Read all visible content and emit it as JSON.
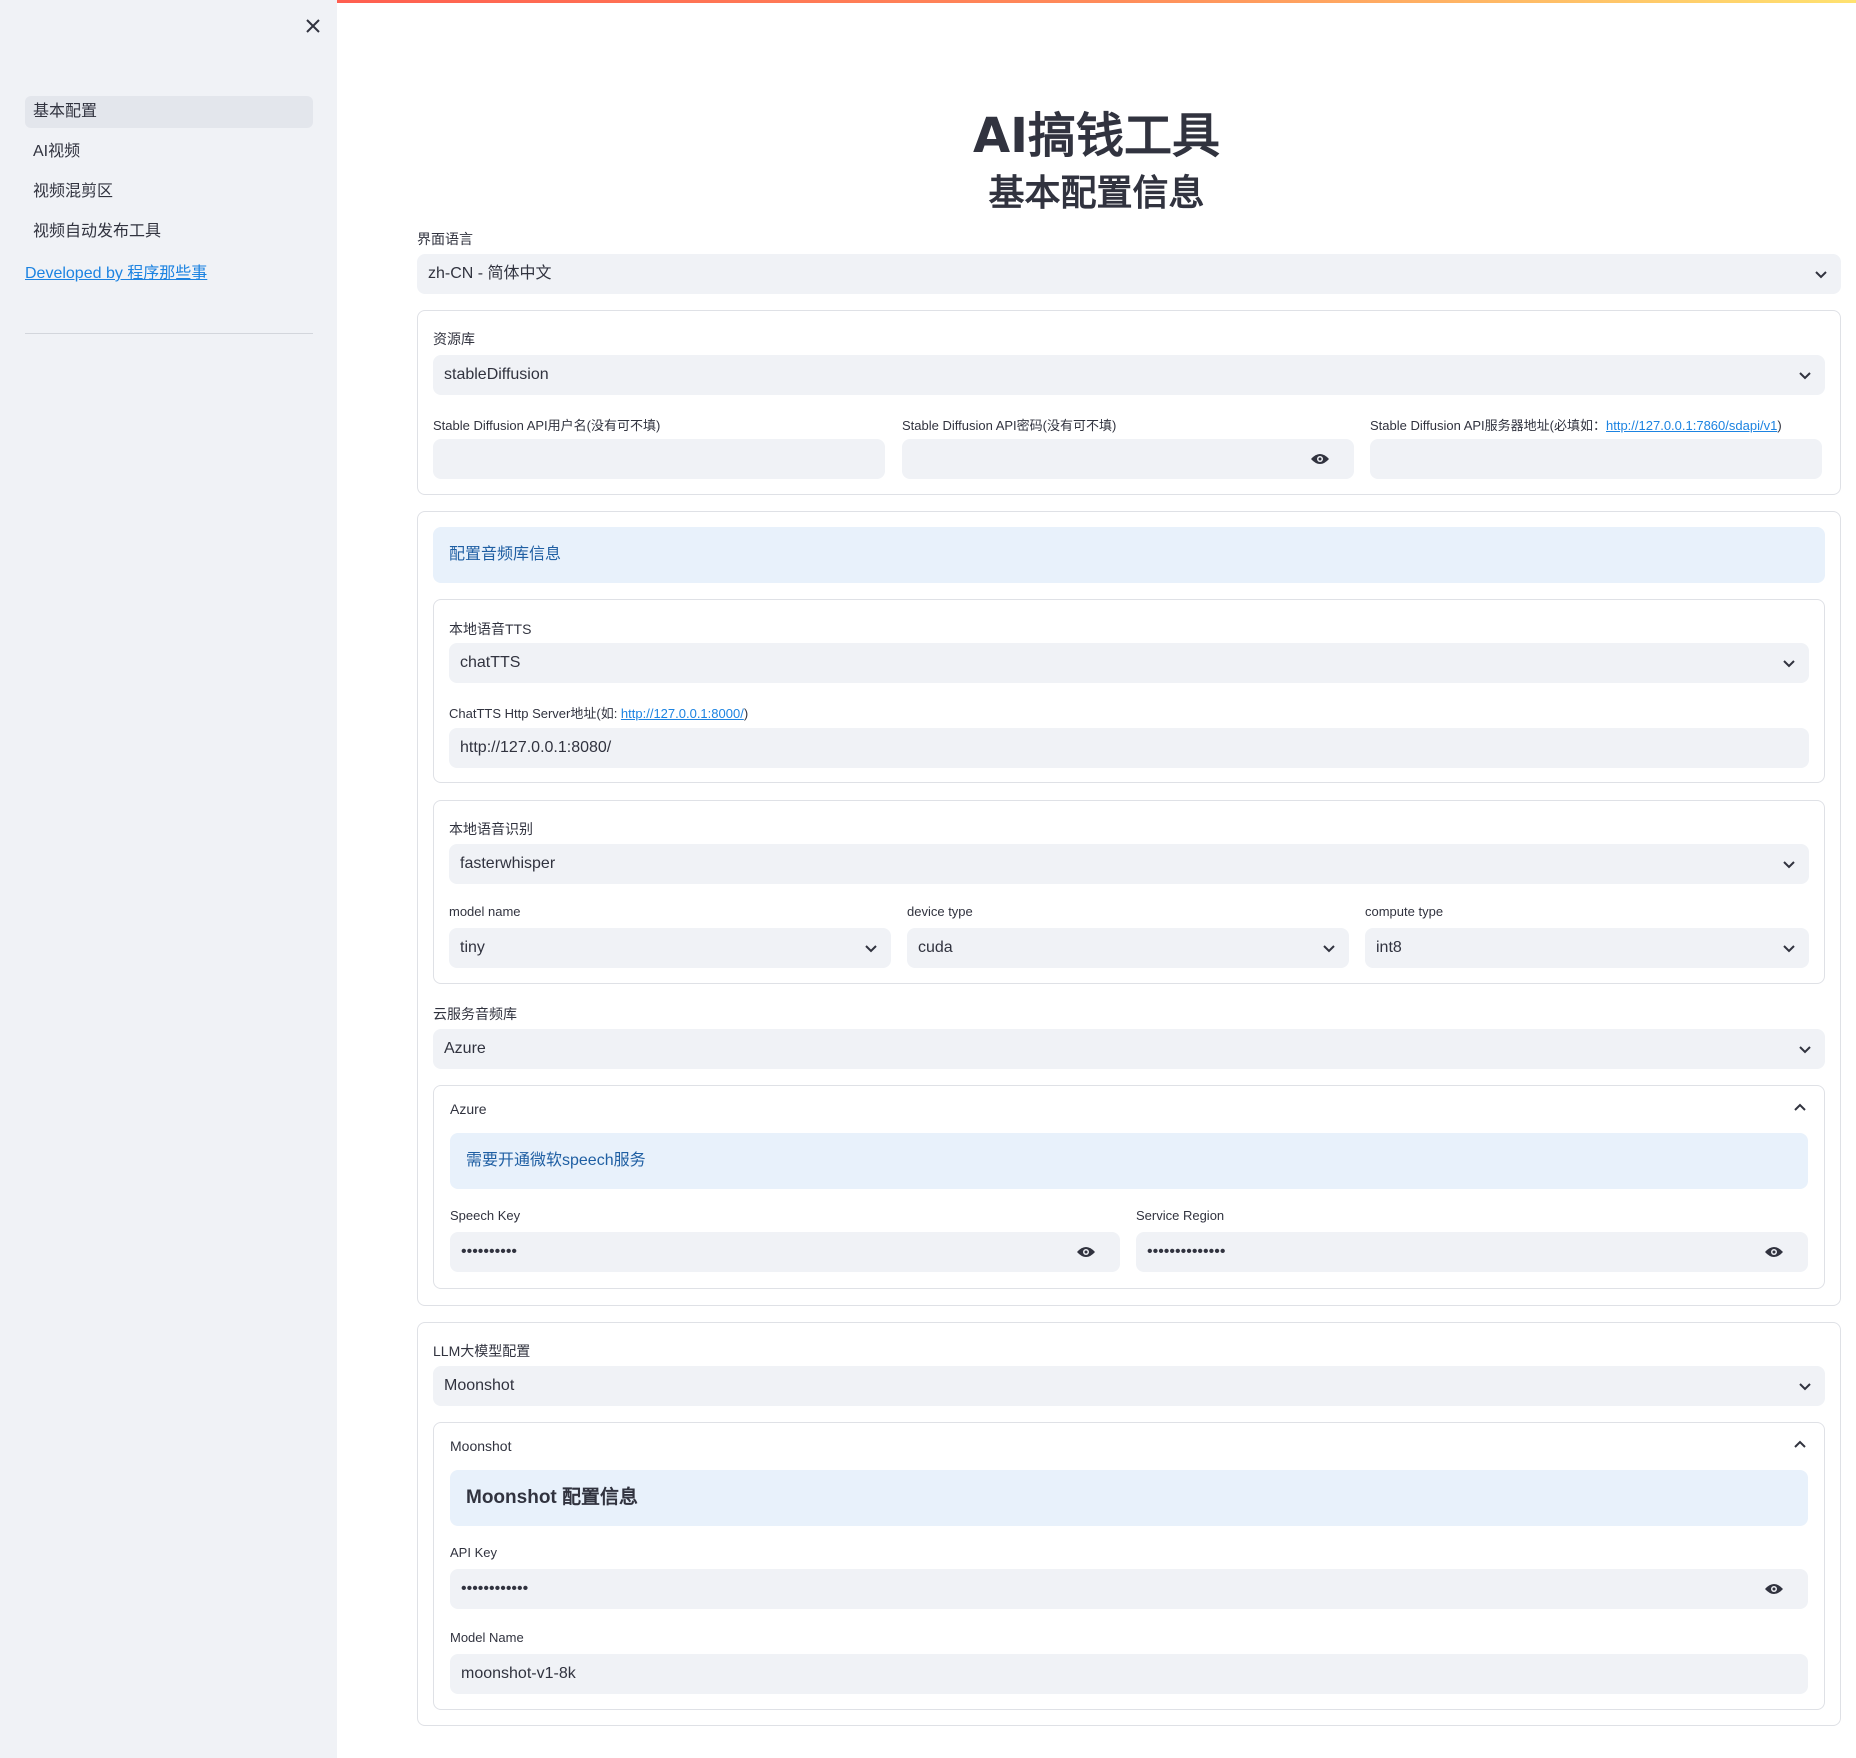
{
  "sidebar": {
    "items": [
      "基本配置",
      "AI视频",
      "视频混剪区",
      "视频自动发布工具"
    ],
    "link": "Developed by 程序那些事"
  },
  "header": {
    "title": "AI搞钱工具",
    "subtitle": "基本配置信息"
  },
  "language": {
    "label": "界面语言",
    "value": "zh-CN - 简体中文"
  },
  "resource": {
    "label": "资源库",
    "value": "stableDiffusion",
    "user_label": "Stable Diffusion API用户名(没有可不填)",
    "pass_label": "Stable Diffusion API密码(没有可不填)",
    "server_label_prefix": "Stable Diffusion API服务器地址(必填如：",
    "server_label_link": "http://127.0.0.1:7860/sdapi/v1",
    "server_label_suffix": ")"
  },
  "audio": {
    "info": "配置音频库信息",
    "tts": {
      "label": "本地语音TTS",
      "value": "chatTTS",
      "server_label_prefix": "ChatTTS Http Server地址(如: ",
      "server_label_link": "http://127.0.0.1:8000/",
      "server_label_suffix": ")",
      "server_value": "http://127.0.0.1:8080/"
    },
    "asr": {
      "label": "本地语音识别",
      "value": "fasterwhisper",
      "model_label": "model name",
      "model_value": "tiny",
      "device_label": "device type",
      "device_value": "cuda",
      "compute_label": "compute type",
      "compute_value": "int8"
    },
    "cloud": {
      "label": "云服务音频库",
      "value": "Azure",
      "expander_title": "Azure",
      "info": "需要开通微软speech服务",
      "key_label": "Speech Key",
      "key_value": "••••••••••",
      "region_label": "Service Region",
      "region_value": "••••••••••••••"
    }
  },
  "llm": {
    "label": "LLM大模型配置",
    "value": "Moonshot",
    "expander_title": "Moonshot",
    "info": "Moonshot 配置信息",
    "api_key_label": "API Key",
    "api_key_value": "••••••••••••",
    "model_label": "Model Name",
    "model_value": "moonshot-v1-8k"
  },
  "colors": {
    "info_bg": "#e8f1fb",
    "info_text": "#1f5fa3",
    "link": "#1c83e1",
    "field_bg": "#f0f2f6"
  },
  "icons": [
    "close-icon",
    "chevron-down-icon",
    "chevron-up-icon",
    "eye-icon"
  ]
}
